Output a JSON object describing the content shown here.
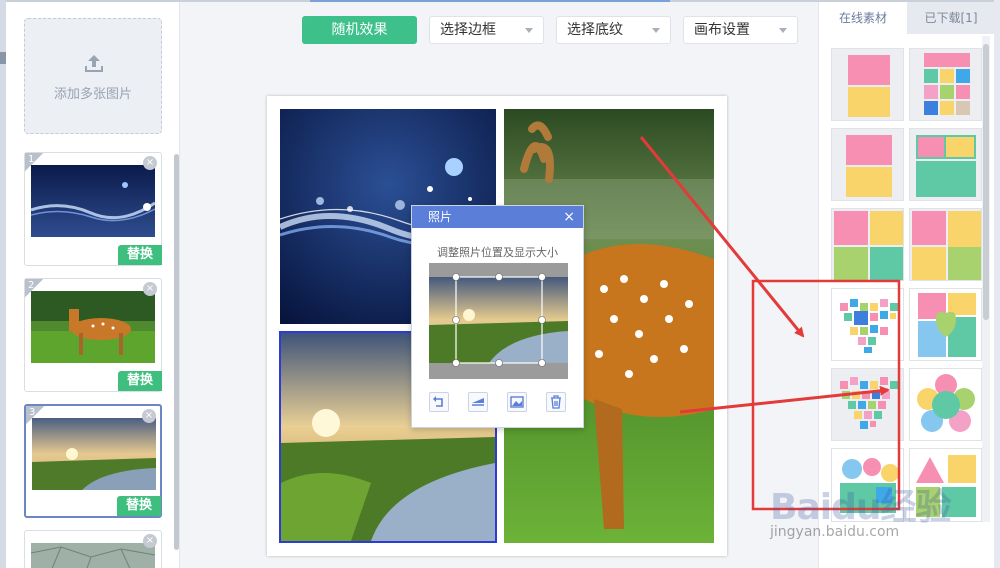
{
  "left_panel": {
    "add_label": "添加多张图片",
    "thumbnails": [
      {
        "number": "1",
        "replace_label": "替换"
      },
      {
        "number": "2",
        "replace_label": "替换"
      },
      {
        "number": "3",
        "replace_label": "替换"
      }
    ]
  },
  "toolbar": {
    "random_label": "随机效果",
    "border_label": "选择边框",
    "texture_label": "选择底纹",
    "canvas_label": "画布设置"
  },
  "photo_dialog": {
    "title": "照片",
    "close_glyph": "×",
    "hint": "调整照片位置及显示大小"
  },
  "right_panel": {
    "tabs": [
      "在线素材",
      "已下载[1]"
    ]
  },
  "watermark": {
    "logo_text": "Baidu经验",
    "url": "jingyan.baidu.com"
  },
  "colors": {
    "accent_green": "#3dc08a",
    "dialog_header": "#5b7fd8",
    "annotation_red": "#e33a3a",
    "selection_blue": "#2c3bd6"
  }
}
